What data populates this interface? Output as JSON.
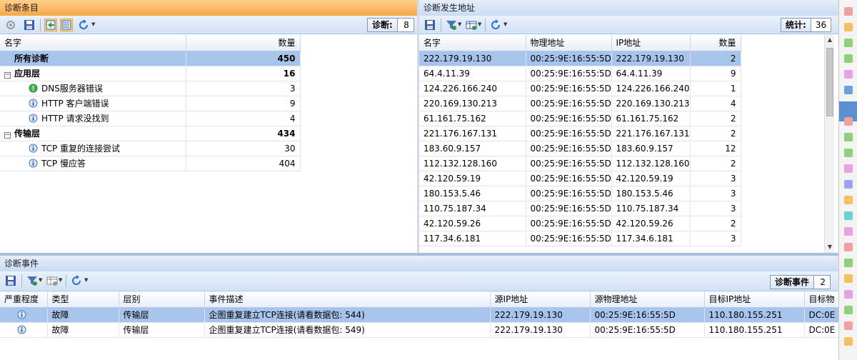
{
  "left_panel": {
    "title": "诊断条目",
    "count_label": "诊断:",
    "count_value": "8",
    "columns": [
      "名字",
      "数量"
    ],
    "rows": [
      {
        "name": "所有诊断",
        "count": "450",
        "level": 0,
        "kind": "all"
      },
      {
        "name": "应用层",
        "count": "16",
        "level": 0,
        "kind": "group"
      },
      {
        "name": "DNS服务器错误",
        "count": "3",
        "level": 1,
        "kind": "green"
      },
      {
        "name": "HTTP 客户端错误",
        "count": "9",
        "level": 1,
        "kind": "info"
      },
      {
        "name": "HTTP 请求没找到",
        "count": "4",
        "level": 1,
        "kind": "info"
      },
      {
        "name": "传输层",
        "count": "434",
        "level": 0,
        "kind": "group"
      },
      {
        "name": "TCP 重复的连接尝试",
        "count": "30",
        "level": 1,
        "kind": "info"
      },
      {
        "name": "TCP 慢应答",
        "count": "404",
        "level": 1,
        "kind": "info"
      }
    ]
  },
  "right_panel": {
    "title": "诊断发生地址",
    "count_label": "统计:",
    "count_value": "36",
    "columns": [
      "名字",
      "物理地址",
      "IP地址",
      "数量"
    ],
    "rows": [
      [
        "222.179.19.130",
        "00:25:9E:16:55:5D",
        "222.179.19.130",
        "2"
      ],
      [
        "64.4.11.39",
        "00:25:9E:16:55:5D",
        "64.4.11.39",
        "9"
      ],
      [
        "124.226.166.240",
        "00:25:9E:16:55:5D",
        "124.226.166.240",
        "1"
      ],
      [
        "220.169.130.213",
        "00:25:9E:16:55:5D",
        "220.169.130.213",
        "4"
      ],
      [
        "61.161.75.162",
        "00:25:9E:16:55:5D",
        "61.161.75.162",
        "2"
      ],
      [
        "221.176.167.131",
        "00:25:9E:16:55:5D",
        "221.176.167.131",
        "2"
      ],
      [
        "183.60.9.157",
        "00:25:9E:16:55:5D",
        "183.60.9.157",
        "12"
      ],
      [
        "112.132.128.160",
        "00:25:9E:16:55:5D",
        "112.132.128.160",
        "2"
      ],
      [
        "42.120.59.19",
        "00:25:9E:16:55:5D",
        "42.120.59.19",
        "3"
      ],
      [
        "180.153.5.46",
        "00:25:9E:16:55:5D",
        "180.153.5.46",
        "3"
      ],
      [
        "110.75.187.34",
        "00:25:9E:16:55:5D",
        "110.75.187.34",
        "3"
      ],
      [
        "42.120.59.26",
        "00:25:9E:16:55:5D",
        "42.120.59.26",
        "2"
      ],
      [
        "117.34.6.181",
        "00:25:9E:16:55:5D",
        "117.34.6.181",
        "3"
      ]
    ]
  },
  "bottom_panel": {
    "title": "诊断事件",
    "count_label": "诊断事件",
    "count_value": "2",
    "columns": [
      "严重程度",
      "类型",
      "层别",
      "事件描述",
      "源IP地址",
      "源物理地址",
      "目标IP地址",
      "目标物"
    ],
    "rows": [
      [
        "",
        "故障",
        "传输层",
        "企图重复建立TCP连接(请看数据包: 544)",
        "222.179.19.130",
        "00:25:9E:16:55:5D",
        "110.180.155.251",
        "DC:0E"
      ],
      [
        "",
        "故障",
        "传输层",
        "企图重复建立TCP连接(请看数据包: 549)",
        "222.179.19.130",
        "00:25:9E:16:55:5D",
        "110.180.155.251",
        "DC:0E"
      ]
    ]
  },
  "colors": {
    "left_title_bg": "#f9b25a",
    "title_bg": "#d6e4f7",
    "selection": "#a7c5ec",
    "group_row_bg": "#c8d9ef"
  }
}
